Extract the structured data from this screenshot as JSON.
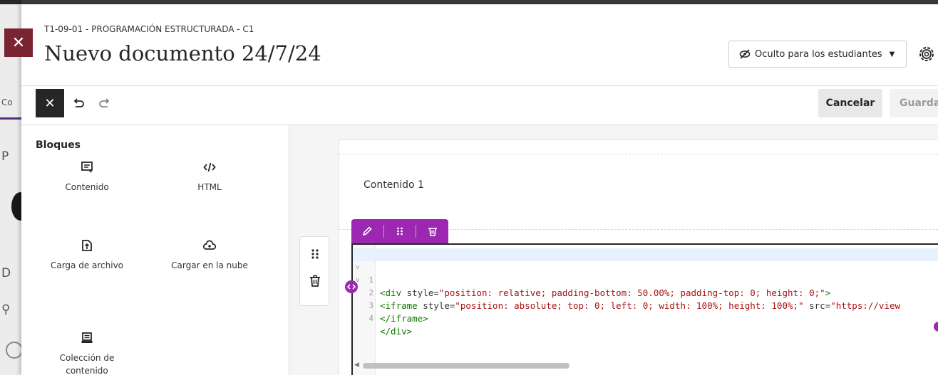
{
  "backdrop": {
    "letter_1": "P",
    "letter_2": "D",
    "fragment": "Co"
  },
  "header": {
    "course_label": "T1-09-01 - PROGRAMACIÓN ESTRUCTURADA - C1",
    "title": "Nuevo documento 24/7/24",
    "visibility_label": "Oculto para los estudiantes"
  },
  "toolbar": {
    "cancel_label": "Cancelar",
    "save_label": "Guardar"
  },
  "sidebar": {
    "title": "Bloques",
    "blocks": [
      {
        "label": "Contenido",
        "icon": "content-block-icon"
      },
      {
        "label": "HTML",
        "icon": "code-icon"
      },
      {
        "label": "Carga de archivo",
        "icon": "file-upload-icon"
      },
      {
        "label": "Cargar en la nube",
        "icon": "cloud-upload-icon"
      },
      {
        "label_line1": "Colección de",
        "label_line2": "contenido",
        "icon": "content-collection-icon"
      }
    ]
  },
  "editor": {
    "content_label": "Contenido 1",
    "code_lines": [
      {
        "num": "1",
        "fold": "v"
      },
      {
        "num": "2",
        "fold": "v"
      },
      {
        "num": "3",
        "fold": ""
      },
      {
        "num": "4",
        "fold": ""
      }
    ],
    "code": {
      "l1_open": "<div",
      "l1_attr": " style=",
      "l1_val": "\"position: relative; padding-bottom: 50.00%; padding-top: 0; height: 0;\"",
      "l1_close": ">",
      "l2_open": "<iframe",
      "l2_attr": " style=",
      "l2_val": "\"position: absolute; top: 0; left: 0; width: 100%; height: 100%;\"",
      "l2_attr2": " src=",
      "l2_val2": "\"https://view",
      "l3": "</iframe>",
      "l4": "</div>"
    }
  },
  "colors": {
    "accent_purple": "#9c27b0",
    "close_tab": "#7a2432",
    "dark": "#262626"
  }
}
